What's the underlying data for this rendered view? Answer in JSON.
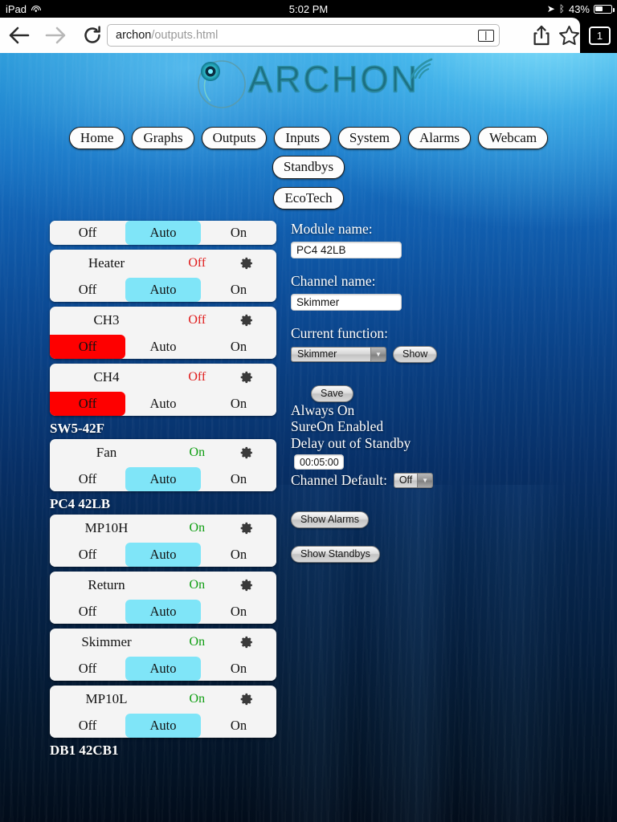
{
  "status_bar": {
    "carrier": "iPad",
    "wifi_icon": "wifi-icon",
    "time": "5:02 PM",
    "location_icon": "location-arrow-icon",
    "bluetooth_icon": "bluetooth-icon",
    "battery_percent": "43%"
  },
  "browser": {
    "back_icon": "back-arrow-icon",
    "forward_icon": "forward-arrow-icon",
    "reload_icon": "reload-icon",
    "url_host": "archon",
    "url_path": "/outputs.html",
    "reader_icon": "reader-view-icon",
    "share_icon": "share-icon",
    "bookmark_icon": "bookmark-star-icon",
    "tab_count": "1"
  },
  "logo": {
    "text": "ARCHON",
    "mark_icon": "archon-circle-logo-icon",
    "signal_icon": "wireless-signal-icon"
  },
  "nav": {
    "row1": [
      {
        "label": "Home"
      },
      {
        "label": "Graphs"
      },
      {
        "label": "Outputs"
      },
      {
        "label": "Inputs"
      },
      {
        "label": "System"
      },
      {
        "label": "Alarms"
      },
      {
        "label": "Webcam"
      },
      {
        "label": "Standbys"
      }
    ],
    "row2": [
      {
        "label": "EcoTech"
      }
    ]
  },
  "outputs": {
    "mode_labels": {
      "off": "Off",
      "auto": "Auto",
      "on": "On"
    },
    "gear_icon": "gear-icon",
    "groups": [
      {
        "label": "",
        "channels": [
          {
            "name": "",
            "status": "",
            "status_state": "",
            "selected": "auto",
            "partial": true,
            "off": "Off",
            "auto": "Auto",
            "on": "On"
          },
          {
            "name": "Heater",
            "status": "Off",
            "status_state": "off",
            "selected": "auto",
            "partial": false,
            "off": "Off",
            "auto": "Auto",
            "on": "On"
          },
          {
            "name": "CH3",
            "status": "Off",
            "status_state": "off",
            "selected": "off",
            "partial": false,
            "off": "Off",
            "auto": "Auto",
            "on": "On"
          },
          {
            "name": "CH4",
            "status": "Off",
            "status_state": "off",
            "selected": "off",
            "partial": false,
            "off": "Off",
            "auto": "Auto",
            "on": "On"
          }
        ]
      },
      {
        "label": "SW5-42F",
        "channels": [
          {
            "name": "Fan",
            "status": "On",
            "status_state": "on",
            "selected": "auto",
            "partial": false,
            "off": "Off",
            "auto": "Auto",
            "on": "On"
          }
        ]
      },
      {
        "label": "PC4 42LB",
        "channels": [
          {
            "name": "MP10H",
            "status": "On",
            "status_state": "on",
            "selected": "auto",
            "partial": false,
            "off": "Off",
            "auto": "Auto",
            "on": "On"
          },
          {
            "name": "Return",
            "status": "On",
            "status_state": "on",
            "selected": "auto",
            "partial": false,
            "off": "Off",
            "auto": "Auto",
            "on": "On"
          },
          {
            "name": "Skimmer",
            "status": "On",
            "status_state": "on",
            "selected": "auto",
            "partial": false,
            "off": "Off",
            "auto": "Auto",
            "on": "On"
          },
          {
            "name": "MP10L",
            "status": "On",
            "status_state": "on",
            "selected": "auto",
            "partial": false,
            "off": "Off",
            "auto": "Auto",
            "on": "On"
          }
        ]
      },
      {
        "label": "DB1 42CB1",
        "channels": []
      }
    ]
  },
  "panel": {
    "module_name_label": "Module name:",
    "module_name_value": "PC4 42LB",
    "channel_name_label": "Channel name:",
    "channel_name_value": "Skimmer",
    "current_function_label": "Current function:",
    "current_function_value": "Skimmer",
    "show_button": "Show",
    "save_button": "Save",
    "always_on": "Always On",
    "sure_on": "SureOn Enabled",
    "delay_label": "Delay out of Standby",
    "delay_value": "00:05:00",
    "channel_default_label": "Channel Default:",
    "channel_default_value": "Off",
    "show_alarms_button": "Show Alarms",
    "show_standbys_button": "Show Standbys"
  },
  "colors": {
    "auto_selected": "#7fe5f8",
    "off_selected": "#fe0000",
    "status_on": "#0f9e12",
    "status_off": "#e01b1b",
    "card_bg": "#f4f4f4"
  }
}
